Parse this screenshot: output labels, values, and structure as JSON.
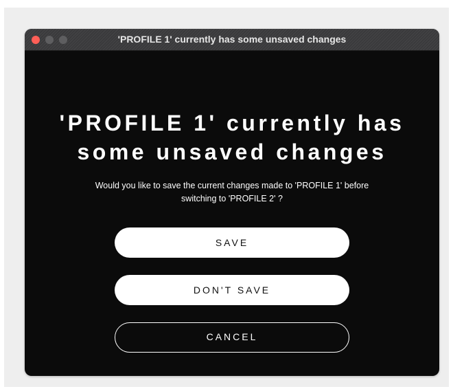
{
  "window": {
    "title": "'PROFILE 1' currently has some unsaved changes"
  },
  "dialog": {
    "heading_line1": "'PROFILE 1' currently has",
    "heading_line2": "some unsaved changes",
    "message_line1": "Would you like to save the current changes made to 'PROFILE 1' before",
    "message_line2": "switching to 'PROFILE 2' ?",
    "buttons": {
      "save": "SAVE",
      "dont_save": "DON'T SAVE",
      "cancel": "CANCEL"
    }
  },
  "colors": {
    "window_background": "#0b0b0b",
    "titlebar": "#3a3a3c",
    "close_light": "#ff5f57",
    "inactive_light": "#5e5e60",
    "button_fill": "#ffffff",
    "text": "#ffffff"
  }
}
